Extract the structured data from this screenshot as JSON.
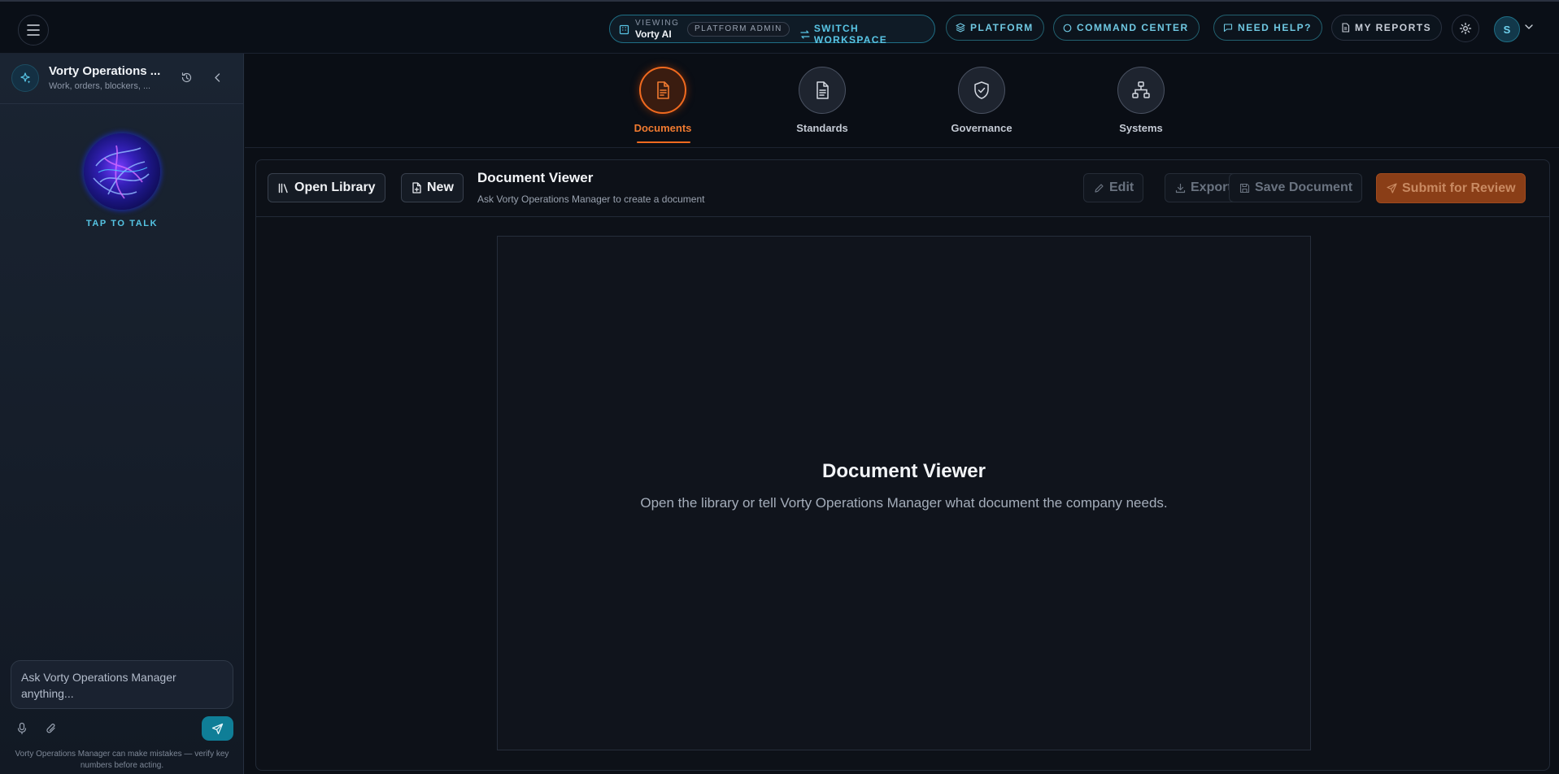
{
  "topbar": {
    "workspace": {
      "viewing_label": "VIEWING",
      "workspace_name": "Vorty AI",
      "role_badge": "PLATFORM ADMIN",
      "switch_label": "SWITCH WORKSPACE"
    },
    "nav": {
      "platform": "PLATFORM",
      "command_center": "COMMAND CENTER",
      "need_help": "NEED HELP?",
      "my_reports": "MY REPORTS"
    },
    "avatar_initial": "S"
  },
  "sidebar": {
    "title": "Vorty Operations ...",
    "subtitle": "Work, orders, blockers, ...",
    "tap_to_talk": "TAP TO TALK",
    "input_placeholder": "Ask Vorty Operations Manager anything...",
    "disclaimer": "Vorty Operations Manager can make mistakes — verify key numbers before acting."
  },
  "tabs": [
    {
      "label": "Documents",
      "icon": "document-icon",
      "active": true
    },
    {
      "label": "Standards",
      "icon": "document-lines-icon",
      "active": false
    },
    {
      "label": "Governance",
      "icon": "shield-check-icon",
      "active": false
    },
    {
      "label": "Systems",
      "icon": "hierarchy-icon",
      "active": false
    }
  ],
  "panel": {
    "open_library": "Open Library",
    "new": "New",
    "title": "Document Viewer",
    "subtitle": "Ask Vorty Operations Manager to create a document",
    "edit": "Edit",
    "export": "Export",
    "save": "Save Document",
    "submit": "Submit for Review",
    "empty_title": "Document Viewer",
    "empty_subtitle": "Open the library or tell Vorty Operations Manager what document the company needs."
  },
  "colors": {
    "accent_orange": "#f06a1f",
    "accent_cyan": "#59c6e6",
    "background": "#0b0f16"
  }
}
